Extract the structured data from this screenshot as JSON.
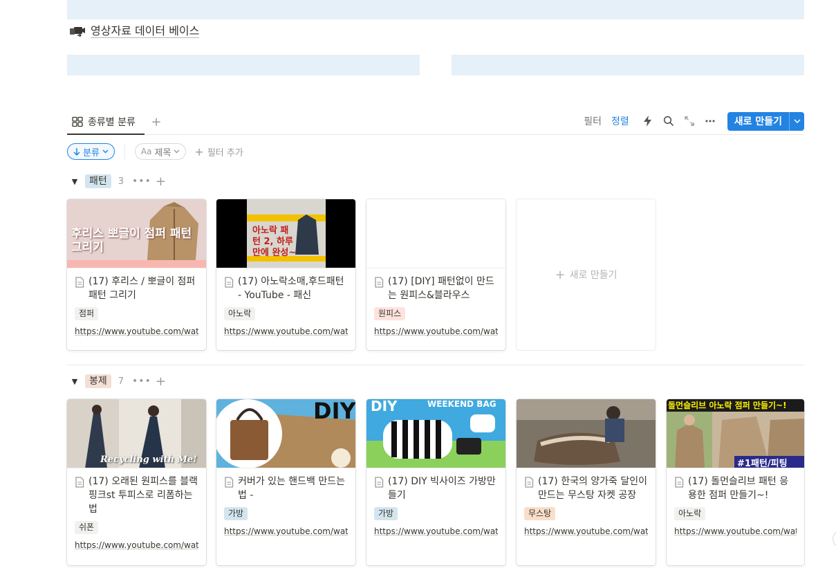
{
  "page_link": {
    "label": "영상자료 데이터 베이스",
    "icon": "video-camera-icon"
  },
  "tabs": {
    "view_label": "종류별 분류"
  },
  "toolbar": {
    "filter": "필터",
    "sort": "정렬",
    "new_button": "새로 만들기"
  },
  "filters": {
    "sort_chip": "분류",
    "prop_aa": "Aa",
    "prop_chip": "제목",
    "add_filter": "필터 추가"
  },
  "groups": [
    {
      "name": "패턴",
      "count": "3",
      "tag_bg": "#d3e5ef",
      "cards": [
        {
          "title": "(17) 후리스 / 뽀글이 점퍼 패턴 그리기",
          "tag": "점퍼",
          "tag_bg": "#f1f1ef",
          "url": "https://www.youtube.com/watch?v=",
          "thumb_text": "후리스 뽀글이 점퍼 패턴 그리기"
        },
        {
          "title": "(17) 아노락소매,후드패턴 - YouTube - 패신",
          "tag": "아노락",
          "tag_bg": "#f1f1ef",
          "url": "https://www.youtube.com/watch?v=",
          "thumb_text": "아노락 패턴 2, 하루만에 완성~"
        },
        {
          "title": "(17) [DIY] 패턴없이 만드는 원피스&블라우스",
          "tag": "원피스",
          "tag_bg": "#ffe2dd",
          "url": "https://www.youtube.com/watch?v="
        }
      ],
      "new_card": "새로 만들기"
    },
    {
      "name": "봉제",
      "count": "7",
      "tag_bg": "#f4dfd7",
      "cards": [
        {
          "title": "(17) 오래된 원피스를 블랙핑크st 투피스로 리폼하는 법",
          "tag": "쉬폰",
          "tag_bg": "#f1f1ef",
          "url": "https://www.youtube.com/watch?v=",
          "thumb_text": "Recycling with Me!"
        },
        {
          "title": "커버가 있는 핸드백 만드는 법 -",
          "tag": "가방",
          "tag_bg": "#d3e5ef",
          "url": "https://www.youtube.com/watch?v=",
          "thumb_text": "DIY"
        },
        {
          "title": "(17) DIY 빅사이즈 가방만들기",
          "tag": "가방",
          "tag_bg": "#d3e5ef",
          "url": "https://www.youtube.com/watch?v=",
          "thumb_text": "WEEKEND BAG"
        },
        {
          "title": "(17) 한국의 양가죽 달인이 만드는 무스탕 자켓 공장",
          "tag": "무스탕",
          "tag_bg": "#fadec9",
          "url": "https://www.youtube.com/watch?v="
        },
        {
          "title": "(17) 돌먼슬리브 패턴 응용한 점퍼 만들기~!",
          "tag": "아노락",
          "tag_bg": "#f1f1ef",
          "url": "https://www.youtube.com/watch?v=",
          "thumb_text": "돌먼슬리브 아노락 점퍼 만들기~!"
        }
      ]
    }
  ],
  "colors": {
    "accent": "#2383e2",
    "banner": "#e6f0f8"
  }
}
